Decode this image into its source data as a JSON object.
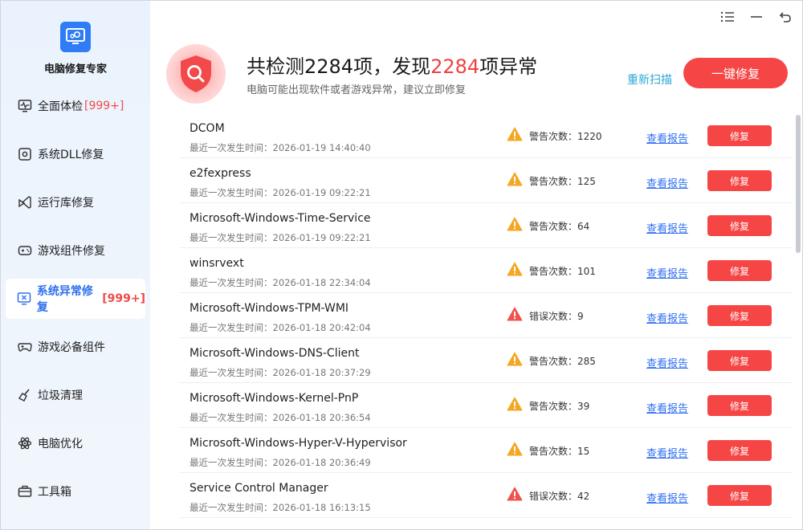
{
  "app": {
    "title": "电脑修复专家"
  },
  "sidebar": {
    "items": [
      {
        "label": "全面体检",
        "badge": "[999+]",
        "icon": "monitor-pulse-icon"
      },
      {
        "label": "系统DLL修复",
        "badge": "",
        "icon": "gear-box-icon"
      },
      {
        "label": "运行库修复",
        "badge": "",
        "icon": "vs-icon"
      },
      {
        "label": "游戏组件修复",
        "badge": "",
        "icon": "gamepad-icon"
      },
      {
        "label": "系统异常修复",
        "badge": "[999+]",
        "icon": "monitor-x-icon",
        "active": true
      },
      {
        "label": "游戏必备组件",
        "badge": "",
        "icon": "gamepad-alt-icon"
      },
      {
        "label": "垃圾清理",
        "badge": "",
        "icon": "broom-icon"
      },
      {
        "label": "电脑优化",
        "badge": "",
        "icon": "atom-icon"
      },
      {
        "label": "工具箱",
        "badge": "",
        "icon": "toolbox-icon"
      }
    ]
  },
  "header": {
    "title_prefix": "共检测",
    "total": "2284",
    "title_mid": "项，发现",
    "abnormal": "2284",
    "title_suffix": "项异常",
    "subtitle": "电脑可能出现软件或者游戏异常，建议立即修复",
    "rescan_label": "重新扫描",
    "fix_all_label": "一键修复"
  },
  "list": {
    "report_label": "查看报告",
    "fix_label": "修复",
    "time_prefix": "最近一次发生时间：",
    "rows": [
      {
        "name": "DCOM",
        "time": "2026-01-19 14:40:40",
        "level": "warning",
        "count_label": "警告次数：",
        "count": "1220"
      },
      {
        "name": "e2fexpress",
        "time": "2026-01-19 09:22:21",
        "level": "warning",
        "count_label": "警告次数：",
        "count": "125"
      },
      {
        "name": "Microsoft-Windows-Time-Service",
        "time": "2026-01-19 09:22:21",
        "level": "warning",
        "count_label": "警告次数：",
        "count": "64"
      },
      {
        "name": "winsrvext",
        "time": "2026-01-18 22:34:04",
        "level": "warning",
        "count_label": "警告次数：",
        "count": "101"
      },
      {
        "name": "Microsoft-Windows-TPM-WMI",
        "time": "2026-01-18 20:42:04",
        "level": "error",
        "count_label": "错误次数：",
        "count": "9"
      },
      {
        "name": "Microsoft-Windows-DNS-Client",
        "time": "2026-01-18 20:37:29",
        "level": "warning",
        "count_label": "警告次数：",
        "count": "285"
      },
      {
        "name": "Microsoft-Windows-Kernel-PnP",
        "time": "2026-01-18 20:36:54",
        "level": "warning",
        "count_label": "警告次数：",
        "count": "39"
      },
      {
        "name": "Microsoft-Windows-Hyper-V-Hypervisor",
        "time": "2026-01-18 20:36:49",
        "level": "warning",
        "count_label": "警告次数：",
        "count": "15"
      },
      {
        "name": "Service Control Manager",
        "time": "2026-01-18 16:13:15",
        "level": "error",
        "count_label": "错误次数：",
        "count": "42"
      }
    ]
  },
  "colors": {
    "accent": "#2f6ff0",
    "danger": "#f64545",
    "warning": "#f5a623",
    "error": "#f0524f",
    "link": "#2aa7d6"
  }
}
